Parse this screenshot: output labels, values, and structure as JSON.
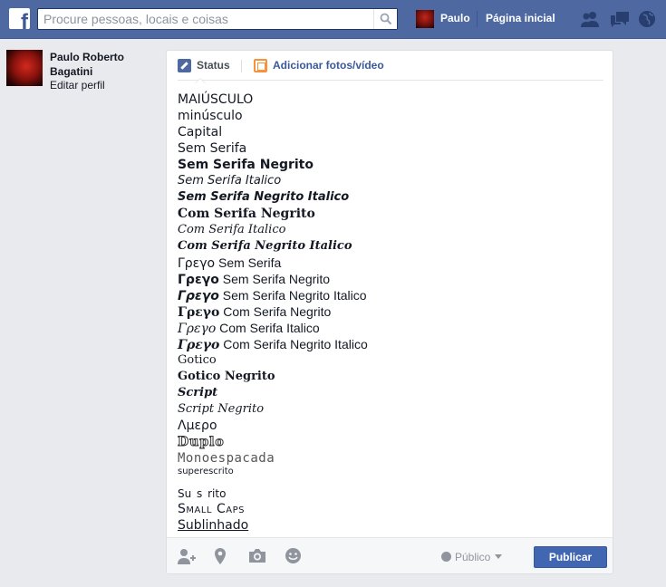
{
  "colors": {
    "topbar": "#4e69a2",
    "accent": "#3b5998",
    "publish": "#4267b2",
    "background": "#e9eaed"
  },
  "topbar": {
    "logo_letter": "f",
    "search_placeholder": "Procure pessoas, locais e coisas",
    "user_name": "Paulo",
    "home_label": "Página inicial",
    "icons": [
      "friends-icon",
      "messages-icon",
      "notifications-globe-icon"
    ]
  },
  "sidebar": {
    "profile_name": "Paulo Roberto Bagatini",
    "edit_profile": "Editar perfil"
  },
  "composer": {
    "tabs": [
      {
        "label": "Status",
        "icon": "pencil-icon"
      },
      {
        "label": "Adicionar fotos/vídeo",
        "icon": "photo-icon"
      }
    ],
    "lines": [
      "MAIÚSCULO",
      "minúsculo",
      "Capital",
      "Sem Serifa",
      "Sem Serifa Negrito",
      "Sem Serifa Italico",
      "Sem Serifa Negrito Italico",
      "Com Serifa Negrito",
      "Com Serifa Italico",
      "Com Serifa Negrito Italico",
      {
        "greek": "Γρεγο",
        "rest": " Sem Serifa"
      },
      {
        "greek": "Γρεγο",
        "rest": " Sem Serifa Negrito"
      },
      {
        "greek": "Γρεγο",
        "rest": " Sem Serifa Negrito Italico"
      },
      {
        "greek": "Γρεγο",
        "rest": " Com Serifa Negrito"
      },
      {
        "greek": "Γρεγο",
        "rest": " Com Serifa Italico"
      },
      {
        "greek": "Γρεγο",
        "rest": " Com Serifa Negrito Italico"
      },
      "Gotico",
      "Gotico Negrito",
      "Script",
      "Script Negrito",
      "Λμερο",
      "Duplo",
      "Monoespacada",
      "superescrito",
      "Su s rito",
      "Small Caps",
      "Sublinhado"
    ],
    "footer": {
      "icons": [
        "tag-friends-icon",
        "location-pin-icon",
        "camera-icon",
        "emoji-icon"
      ],
      "privacy_label": "Público",
      "publish_label": "Publicar"
    }
  }
}
